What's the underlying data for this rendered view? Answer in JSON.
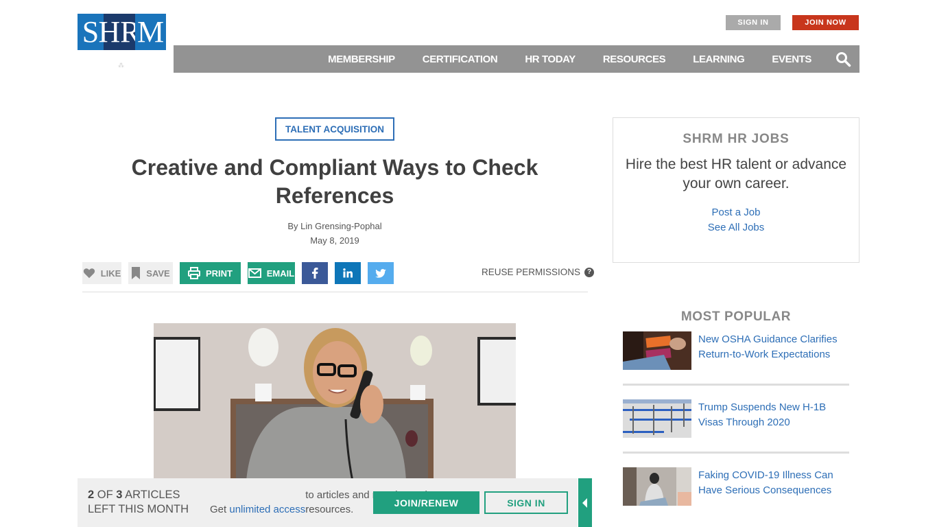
{
  "header": {
    "logo": {
      "letters": [
        "S",
        "HR",
        "M"
      ],
      "alt": "SHRM"
    },
    "sign_in_label": "SIGN IN",
    "join_now_label": "JOIN NOW",
    "nav": [
      {
        "label": "MEMBERSHIP"
      },
      {
        "label": "CERTIFICATION"
      },
      {
        "label": "HR TODAY"
      },
      {
        "label": "RESOURCES"
      },
      {
        "label": "LEARNING"
      },
      {
        "label": "EVENTS"
      }
    ],
    "search_icon": "search-icon"
  },
  "article": {
    "category": "TALENT ACQUISITION",
    "title": "Creative and Compliant Ways to Check References",
    "author": "By Lin Grensing-Pophal",
    "date": "May 8, 2019",
    "actions": {
      "like": "LIKE",
      "save": "SAVE",
      "print": "PRINT",
      "email": "EMAIL",
      "social": [
        "facebook-icon",
        "linkedin-icon",
        "twitter-icon"
      ]
    },
    "reuse_permissions": "REUSE PERMISSIONS",
    "hero_alt": "Woman with glasses smiling while talking on a desk phone"
  },
  "sidebar": {
    "jobs": {
      "heading": "SHRM HR JOBS",
      "tagline": "Hire the best HR talent or advance your own career.",
      "links": [
        "Post a Job",
        "See All Jobs"
      ]
    },
    "most_popular": {
      "heading": "MOST POPULAR",
      "items": [
        {
          "title": "New OSHA Guidance Clarifies Return-to-Work Expectations"
        },
        {
          "title": "Trump Suspends New H-1B Visas Through 2020"
        },
        {
          "title": "Faking COVID-19 Illness Can Have Serious Consequences"
        }
      ]
    }
  },
  "meter": {
    "used": "2",
    "of_label": "OF",
    "total": "3",
    "articles_label": "ARTICLES",
    "left_label": "LEFT THIS MONTH",
    "msg_prefix": "Get ",
    "msg_link": "unlimited access",
    "msg_suffix": " to articles and member-only resources.",
    "join_renew": "JOIN/RENEW",
    "sign_in": "SIGN IN"
  },
  "colors": {
    "brand_blue": "#1a74bb",
    "brand_navy": "#1b3a6b",
    "join_red": "#c8361c",
    "nav_gray": "#939393",
    "teal": "#21a07f",
    "link_blue": "#2d6eb6",
    "facebook": "#3b5998",
    "linkedin": "#0e76b8",
    "twitter": "#55acee"
  }
}
